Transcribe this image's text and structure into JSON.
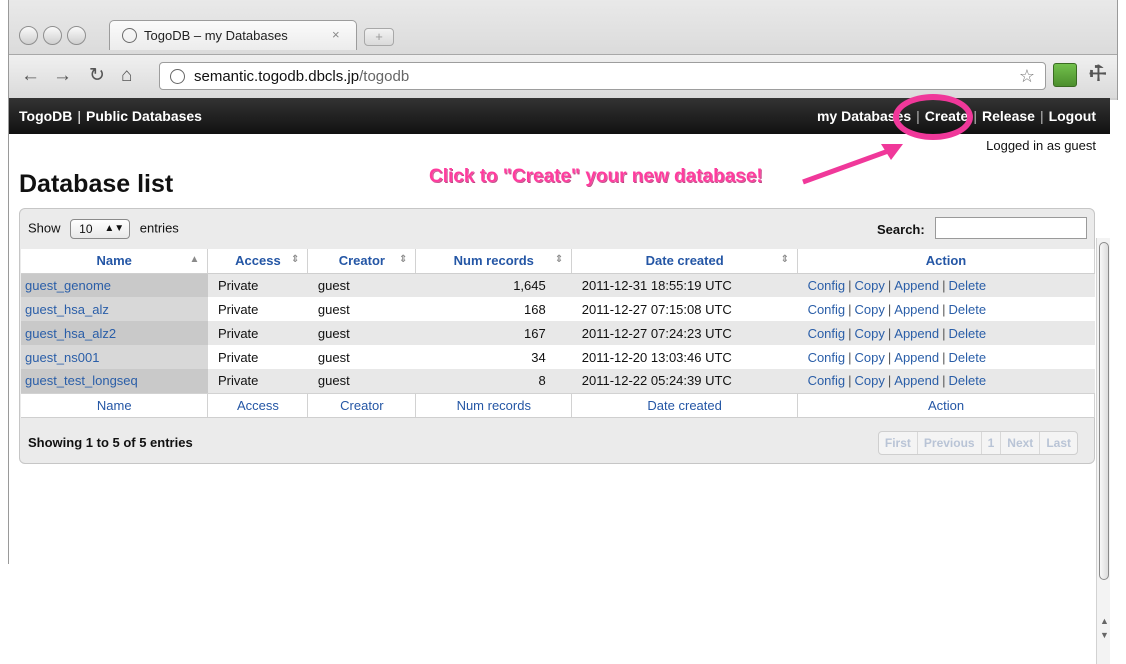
{
  "browser": {
    "tab_title": "TogoDB – my Databases",
    "tab_close": "×",
    "new_tab": "+",
    "url_host": "semantic.togodb.dbcls.jp",
    "url_path": "/togodb"
  },
  "topbar": {
    "brand": "TogoDB",
    "brand_sep": "|",
    "public_databases": "Public Databases",
    "nav": [
      "my Databases",
      "Create",
      "Release",
      "Logout"
    ],
    "nav_sep": "|",
    "logged_in": "Logged in as guest"
  },
  "page": {
    "title": "Database list",
    "callout": "Click to \"Create\" your new database!"
  },
  "table_controls": {
    "show_label": "Show",
    "entries_value": "10",
    "entries_label": "entries",
    "search_label": "Search:",
    "search_value": ""
  },
  "table": {
    "columns": [
      "Name",
      "Access",
      "Creator",
      "Num records",
      "Date created",
      "Action"
    ],
    "rows": [
      {
        "name": "guest_genome",
        "access": "Private",
        "creator": "guest",
        "num_records": "1,645",
        "date_created": "2011-12-31 18:55:19 UTC"
      },
      {
        "name": "guest_hsa_alz",
        "access": "Private",
        "creator": "guest",
        "num_records": "168",
        "date_created": "2011-12-27 07:15:08 UTC"
      },
      {
        "name": "guest_hsa_alz2",
        "access": "Private",
        "creator": "guest",
        "num_records": "167",
        "date_created": "2011-12-27 07:24:23 UTC"
      },
      {
        "name": "guest_ns001",
        "access": "Private",
        "creator": "guest",
        "num_records": "34",
        "date_created": "2011-12-20 13:03:46 UTC"
      },
      {
        "name": "guest_test_longseq",
        "access": "Private",
        "creator": "guest",
        "num_records": "8",
        "date_created": "2011-12-22 05:24:39 UTC"
      }
    ],
    "actions": [
      "Config",
      "Copy",
      "Append",
      "Delete"
    ],
    "action_sep": "|"
  },
  "footer": {
    "info": "Showing 1 to 5 of 5 entries",
    "pager": [
      "First",
      "Previous",
      "1",
      "Next",
      "Last"
    ]
  },
  "colors": {
    "accent_pink": "#f0389a",
    "link_blue": "#2a5ea8",
    "topbar_bg": "#1a1a1a"
  }
}
